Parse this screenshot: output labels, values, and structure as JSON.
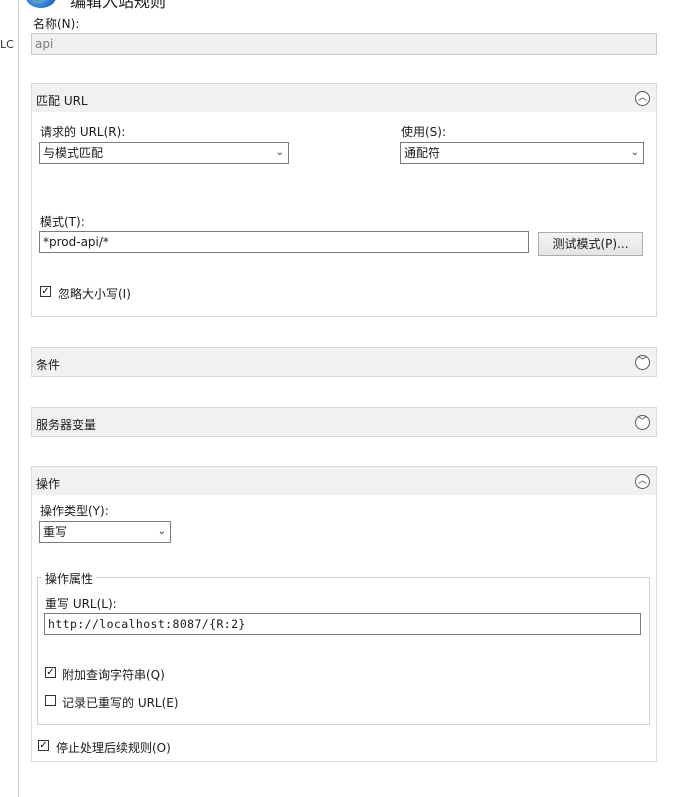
{
  "window": {
    "title_fragment": "编辑入站规则",
    "left_fragment": "LC"
  },
  "name_field": {
    "label": "名称(N):",
    "value": "api"
  },
  "match_url": {
    "title": "匹配 URL",
    "requested_url_label": "请求的 URL(R):",
    "requested_url_value": "与模式匹配",
    "using_label": "使用(S):",
    "using_value": "通配符",
    "pattern_label": "模式(T):",
    "pattern_value": "*prod-api/*",
    "test_pattern_button": "测试模式(P)...",
    "ignore_case_label": "忽略大小写(I)",
    "ignore_case_checked": true
  },
  "conditions": {
    "title": "条件"
  },
  "server_variables": {
    "title": "服务器变量"
  },
  "action": {
    "title": "操作",
    "action_type_label": "操作类型(Y):",
    "action_type_value": "重写",
    "properties_title": "操作属性",
    "rewrite_url_label": "重写 URL(L):",
    "rewrite_url_value": "http://localhost:8087/{R:2}",
    "append_query_label": "附加查询字符串(Q)",
    "append_query_checked": true,
    "log_rewritten_label": "记录已重写的 URL(E)",
    "log_rewritten_checked": false,
    "stop_processing_label": "停止处理后续规则(O)",
    "stop_processing_checked": true
  },
  "icons": {
    "collapse": "chevron-up-icon",
    "expand": "chevron-down-icon",
    "dropdown": "dropdown-arrow-icon",
    "check": "checkmark-icon"
  }
}
